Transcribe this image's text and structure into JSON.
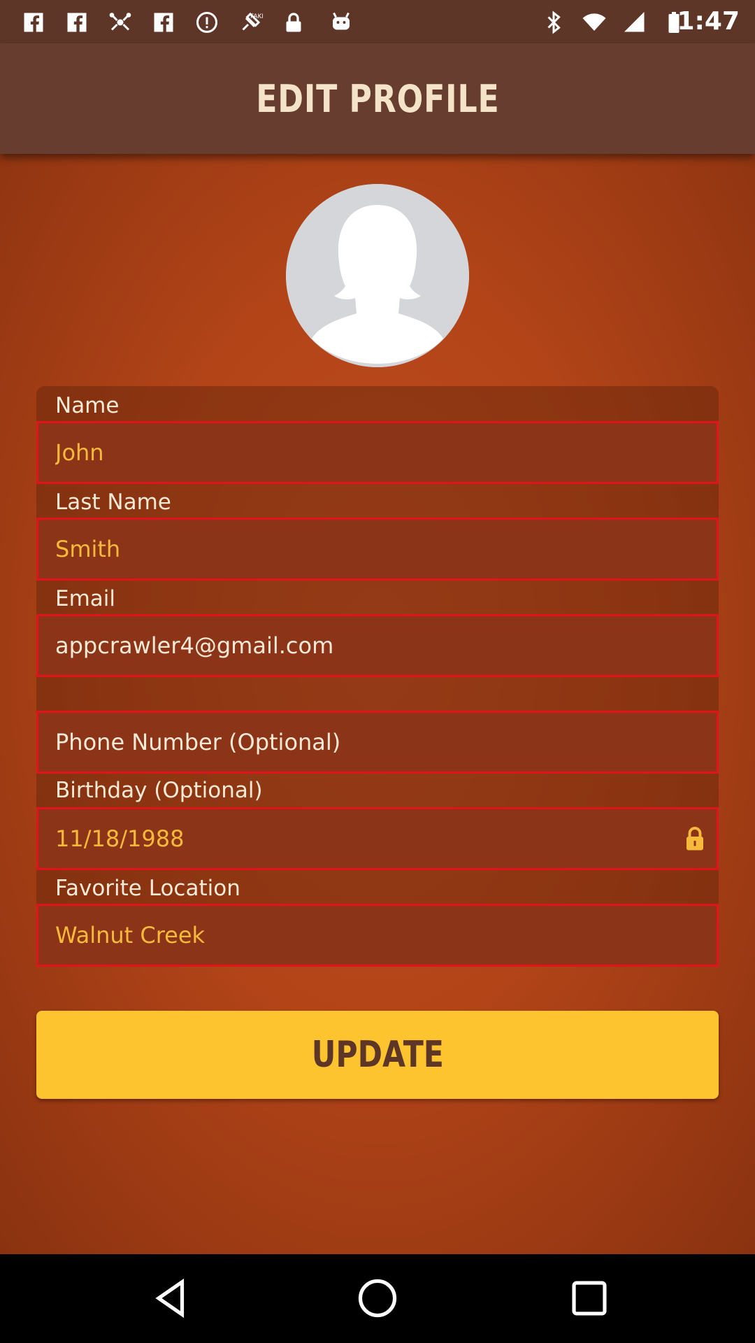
{
  "status_bar": {
    "time": "1:47",
    "left_icons": [
      "fb-icon",
      "fb-icon",
      "drone-icon",
      "fb-icon",
      "info-icon",
      "fake-gps-icon",
      "lock-icon",
      "android-icon"
    ],
    "right_icons": [
      "bluetooth-icon",
      "wifi-icon",
      "signal-icon",
      "battery-icon"
    ],
    "fake_gps_badge": "FAKE"
  },
  "header": {
    "title": "EDIT PROFILE"
  },
  "profile": {
    "avatar": "avatar-placeholder-icon"
  },
  "form": {
    "fields": [
      {
        "label": "Name",
        "value": "John"
      },
      {
        "label": "Last Name",
        "value": "Smith"
      },
      {
        "label": "Email",
        "value": "appcrawler4@gmail.com"
      },
      {
        "label": "",
        "value": "",
        "placeholder": "Phone Number (Optional)"
      },
      {
        "label": "Birthday (Optional)",
        "value": "11/18/1988",
        "locked": true
      },
      {
        "label": "Favorite Location",
        "value": "Walnut Creek"
      }
    ]
  },
  "actions": {
    "update_label": "UPDATE"
  },
  "nav": {
    "back": "back-icon",
    "home": "home-icon",
    "recents": "recents-icon"
  },
  "colors": {
    "header_bg": "#663d2e",
    "field_border": "#e0141a",
    "value_text": "#f6b93b",
    "button_bg": "#fdc430",
    "button_text": "#5e3628"
  }
}
